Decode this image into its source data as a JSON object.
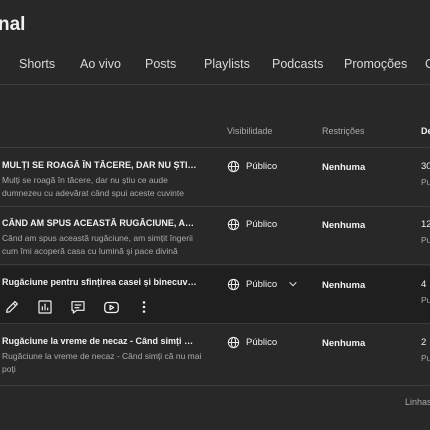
{
  "header": {
    "title": "nal"
  },
  "tabs": [
    {
      "label": "Shorts"
    },
    {
      "label": "Ao vivo"
    },
    {
      "label": "Posts"
    },
    {
      "label": "Playlists"
    },
    {
      "label": "Podcasts"
    },
    {
      "label": "Promoções"
    },
    {
      "label": "C"
    }
  ],
  "table": {
    "columns": {
      "visibility": "Visibilidade",
      "restrictions": "Restrições",
      "date": "De"
    },
    "rows": [
      {
        "title": "MULȚI SE ROAGĂ ÎN TĂCERE, DAR NU ȘTIU CE…",
        "description": "Mulți se roagă în tăcere, dar nu știu ce aude dumnezeu cu adevărat când spui aceste cuvinte",
        "visibility": "Público",
        "restriction": "Nenhuma",
        "date": "30",
        "date_sub": "Pu"
      },
      {
        "title": "CÂND AM SPUS ACEASTĂ RUGĂCIUNE, AM SI…",
        "description": "Când am spus această rugăciune, am simțit îngerii cum îmi acoperă casa cu lumină și pace divină",
        "visibility": "Público",
        "restriction": "Nenhuma",
        "date": "12",
        "date_sub": "Pu"
      },
      {
        "title": "Rugăciune pentru sfințirea casei și binecuvânt…",
        "description": "",
        "visibility": "Público",
        "restriction": "Nenhuma",
        "date": "4",
        "date_sub": "Pu"
      },
      {
        "title": "Rugăciune la vreme de necaz - Când simți că n…",
        "description": "Rugăciune la vreme de necaz - Când simți că nu mai poți",
        "visibility": "Público",
        "restriction": "Nenhuma",
        "date": "2",
        "date_sub": "Pu"
      }
    ],
    "hover_actions": [
      "edit-icon",
      "analytics-icon",
      "comments-icon",
      "youtube-icon",
      "more-vert-icon"
    ]
  },
  "footer": {
    "rows_per_page": "Linhas"
  },
  "colors": {
    "background": "#282828",
    "hover_row": "#1f1f1f",
    "text": "#f1f1f1",
    "muted": "#aaaaaa"
  }
}
